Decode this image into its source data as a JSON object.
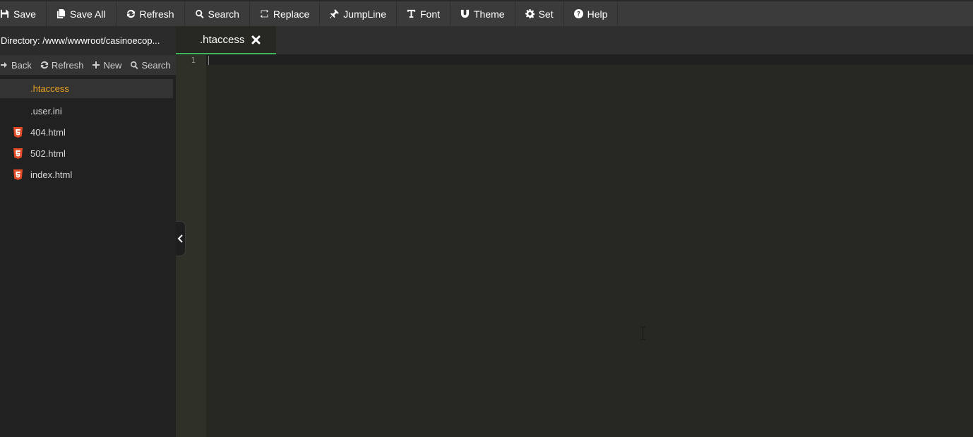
{
  "toolbar": {
    "buttons": [
      {
        "label": "Save",
        "icon": "floppy-disk-icon"
      },
      {
        "label": "Save All",
        "icon": "files-icon"
      },
      {
        "label": "Refresh",
        "icon": "refresh-icon"
      },
      {
        "label": "Search",
        "icon": "search-icon"
      },
      {
        "label": "Replace",
        "icon": "replace-icon"
      },
      {
        "label": "JumpLine",
        "icon": "pin-icon"
      },
      {
        "label": "Font",
        "icon": "text-icon"
      },
      {
        "label": "Theme",
        "icon": "magnet-icon"
      },
      {
        "label": "Set",
        "icon": "gear-icon"
      },
      {
        "label": "Help",
        "icon": "question-icon"
      }
    ]
  },
  "sidebar": {
    "directory": "Directory: /www/wwwroot/casinoecop...",
    "actions": [
      {
        "label": "Back",
        "icon": "back-arrow-icon"
      },
      {
        "label": "Refresh",
        "icon": "refresh-icon"
      },
      {
        "label": "New",
        "icon": "plus-icon"
      },
      {
        "label": "Search",
        "icon": "search-icon"
      }
    ],
    "files": [
      {
        "name": ".htaccess",
        "icon": "none",
        "active": true
      },
      {
        "name": ".user.ini",
        "icon": "none",
        "active": false
      },
      {
        "name": "404.html",
        "icon": "html5-icon",
        "active": false
      },
      {
        "name": "502.html",
        "icon": "html5-icon",
        "active": false
      },
      {
        "name": "index.html",
        "icon": "html5-icon",
        "active": false
      }
    ]
  },
  "tabs": [
    {
      "label": ".htaccess",
      "active": true
    }
  ],
  "editor": {
    "line_numbers": [
      "1"
    ]
  },
  "colors": {
    "active_file": "#e8a31f",
    "tab_underline": "#3fb55c",
    "html_icon": "#e34c26"
  }
}
